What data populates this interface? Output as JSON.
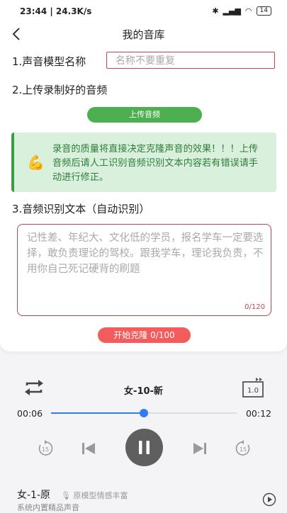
{
  "status": {
    "time": "23:44 | 24.3K/s",
    "battery": "14"
  },
  "header": {
    "title": "我的音库"
  },
  "form": {
    "step1_label": "1.声音模型名称",
    "name_placeholder": "名称不要重复",
    "step2_label": "2.上传录制好的音频",
    "upload_button": "上传音频",
    "tip_emoji": "💪",
    "tip_text": "录音的质量将直接决定克隆声音的效果！！！上传音频后请人工识别音频识别文本内容若有错误请手动进行修正。",
    "step3_label": "3.音频识别文本（自动识别）",
    "text_placeholder": "记性差、年纪大、文化低的学员，报名学车一定要选择，敢负责理论的驾校。跟我学车，理论我负责，不用你自己死记硬背的刷题",
    "char_count": "0/120",
    "clone_button": "开始克隆 0/100"
  },
  "player": {
    "track_title": "女-10-新",
    "speed_label": "1.0",
    "current_time": "00:06",
    "total_time": "00:12",
    "progress": 0.5,
    "rewind_label": "15",
    "forward_label": "15"
  },
  "list": {
    "item_name": "女-1-原",
    "item_tag": "原模型情感丰富",
    "item_sub": "系统内置精品声音"
  }
}
